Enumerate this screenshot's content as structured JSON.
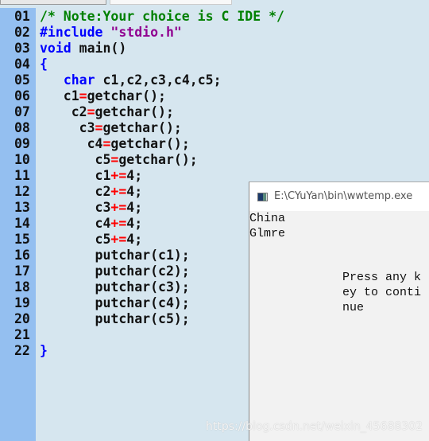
{
  "editor": {
    "lines": [
      {
        "n": "01",
        "tokens": [
          {
            "t": "/* Note:Your choice is C IDE */",
            "c": "comment"
          }
        ]
      },
      {
        "n": "02",
        "tokens": [
          {
            "t": "#include ",
            "c": "keyword"
          },
          {
            "t": "\"stdio.h\"",
            "c": "string"
          }
        ]
      },
      {
        "n": "03",
        "tokens": [
          {
            "t": "void",
            "c": "keyword"
          },
          {
            "t": " main()",
            "c": "normal"
          }
        ]
      },
      {
        "n": "04",
        "tokens": [
          {
            "t": "{",
            "c": "keyword"
          }
        ]
      },
      {
        "n": "05",
        "tokens": [
          {
            "t": "   ",
            "c": "normal"
          },
          {
            "t": "char",
            "c": "keyword"
          },
          {
            "t": " c1,c2,c3,c4,c5;",
            "c": "normal"
          }
        ]
      },
      {
        "n": "06",
        "tokens": [
          {
            "t": "   c1",
            "c": "normal"
          },
          {
            "t": "=",
            "c": "op"
          },
          {
            "t": "getchar();",
            "c": "normal"
          }
        ]
      },
      {
        "n": "07",
        "tokens": [
          {
            "t": "    c2",
            "c": "normal"
          },
          {
            "t": "=",
            "c": "op"
          },
          {
            "t": "getchar();",
            "c": "normal"
          }
        ]
      },
      {
        "n": "08",
        "tokens": [
          {
            "t": "     c3",
            "c": "normal"
          },
          {
            "t": "=",
            "c": "op"
          },
          {
            "t": "getchar();",
            "c": "normal"
          }
        ]
      },
      {
        "n": "09",
        "tokens": [
          {
            "t": "      c4",
            "c": "normal"
          },
          {
            "t": "=",
            "c": "op"
          },
          {
            "t": "getchar();",
            "c": "normal"
          }
        ]
      },
      {
        "n": "10",
        "tokens": [
          {
            "t": "       c5",
            "c": "normal"
          },
          {
            "t": "=",
            "c": "op"
          },
          {
            "t": "getchar();",
            "c": "normal"
          }
        ]
      },
      {
        "n": "11",
        "tokens": [
          {
            "t": "       c1",
            "c": "normal"
          },
          {
            "t": "+=",
            "c": "op"
          },
          {
            "t": "4;",
            "c": "normal"
          }
        ]
      },
      {
        "n": "12",
        "tokens": [
          {
            "t": "       c2",
            "c": "normal"
          },
          {
            "t": "+=",
            "c": "op"
          },
          {
            "t": "4;",
            "c": "normal"
          }
        ]
      },
      {
        "n": "13",
        "tokens": [
          {
            "t": "       c3",
            "c": "normal"
          },
          {
            "t": "+=",
            "c": "op"
          },
          {
            "t": "4;",
            "c": "normal"
          }
        ]
      },
      {
        "n": "14",
        "tokens": [
          {
            "t": "       c4",
            "c": "normal"
          },
          {
            "t": "+=",
            "c": "op"
          },
          {
            "t": "4;",
            "c": "normal"
          }
        ]
      },
      {
        "n": "15",
        "tokens": [
          {
            "t": "       c5",
            "c": "normal"
          },
          {
            "t": "+=",
            "c": "op"
          },
          {
            "t": "4;",
            "c": "normal"
          }
        ]
      },
      {
        "n": "16",
        "tokens": [
          {
            "t": "       putchar(c1);",
            "c": "normal"
          }
        ]
      },
      {
        "n": "17",
        "tokens": [
          {
            "t": "       putchar(c2);",
            "c": "normal"
          }
        ]
      },
      {
        "n": "18",
        "tokens": [
          {
            "t": "       putchar(c3);",
            "c": "normal"
          }
        ]
      },
      {
        "n": "19",
        "tokens": [
          {
            "t": "       putchar(c4);",
            "c": "normal"
          }
        ]
      },
      {
        "n": "20",
        "tokens": [
          {
            "t": "       putchar(c5);",
            "c": "normal"
          }
        ]
      },
      {
        "n": "21",
        "tokens": []
      },
      {
        "n": "22",
        "tokens": [
          {
            "t": "}",
            "c": "keyword"
          }
        ]
      }
    ]
  },
  "console": {
    "title": "E:\\CYuYan\\bin\\wwtemp.exe",
    "output_line1": "China",
    "output_line2": "Glmre",
    "prompt": "Press any key to continue"
  },
  "watermark": "https://blog.csdn.net/weixin_45688302"
}
